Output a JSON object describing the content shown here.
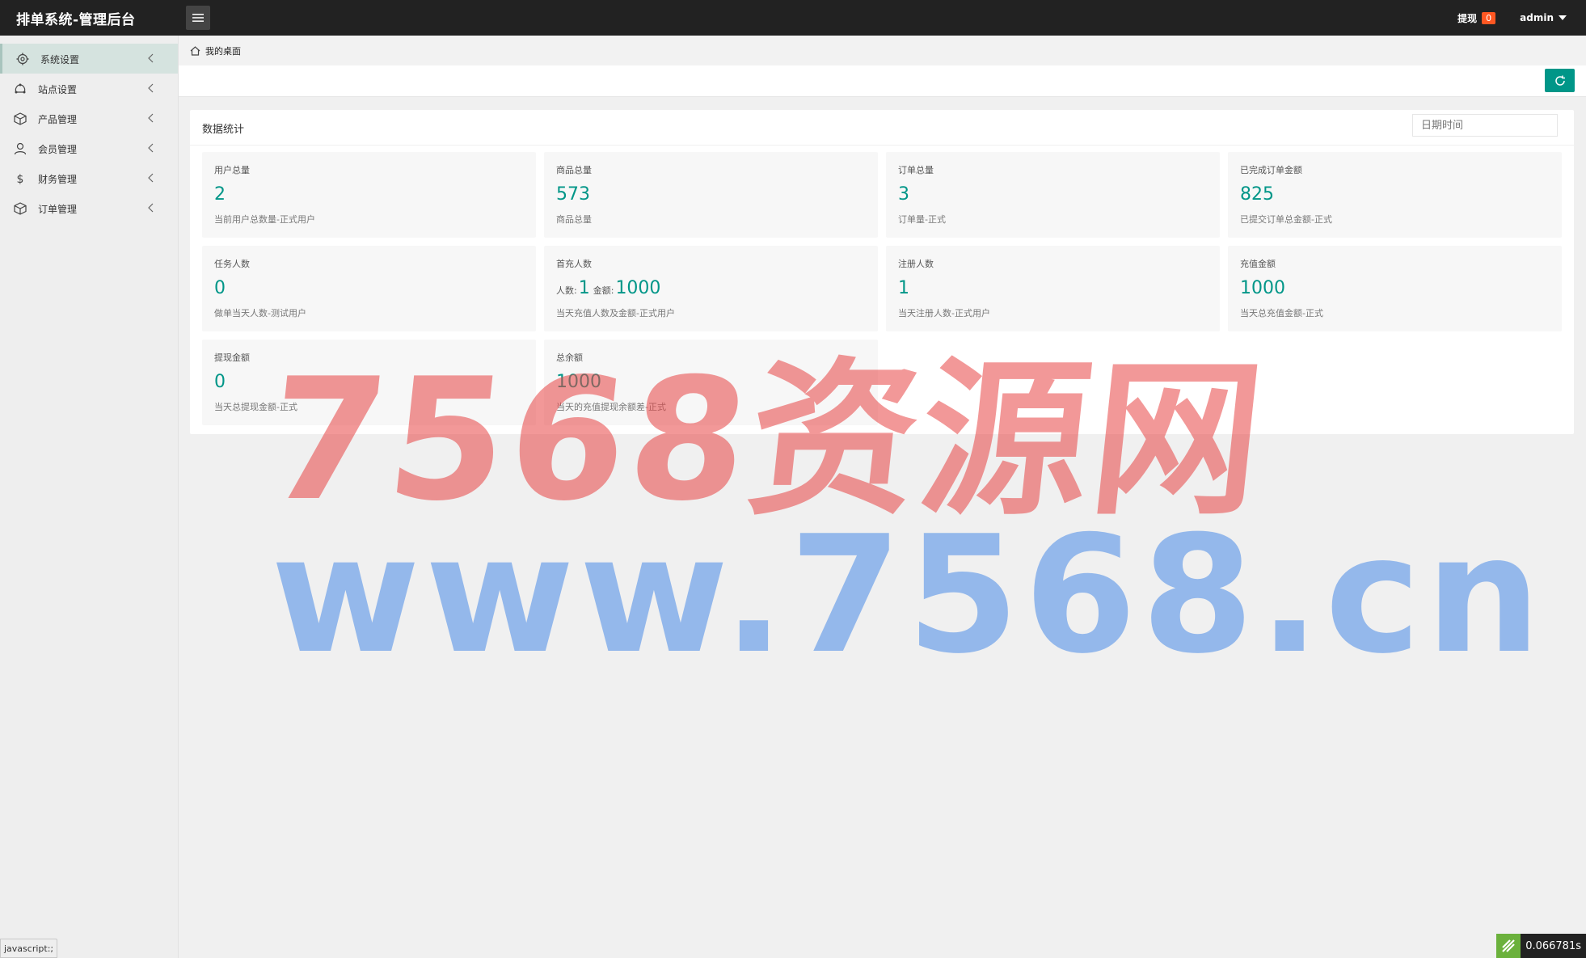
{
  "app": {
    "title": "排单系统-管理后台"
  },
  "topbar": {
    "withdraw_label": "提现",
    "withdraw_count": "0",
    "user": "admin"
  },
  "sidebar": {
    "items": [
      {
        "label": "系统设置",
        "icon": "gear-icon",
        "active": true
      },
      {
        "label": "站点设置",
        "icon": "sitemap-icon",
        "active": false
      },
      {
        "label": "产品管理",
        "icon": "box-icon",
        "active": false
      },
      {
        "label": "会员管理",
        "icon": "user-icon",
        "active": false
      },
      {
        "label": "财务管理",
        "icon": "dollar-icon",
        "active": false
      },
      {
        "label": "订单管理",
        "icon": "box-icon",
        "active": false
      }
    ]
  },
  "breadcrumb": {
    "label": "我的桌面"
  },
  "panel": {
    "title": "数据统计",
    "date_placeholder": "日期时间"
  },
  "cards": [
    {
      "title": "用户总量",
      "value": "2",
      "desc": "当前用户总数量-正式用户"
    },
    {
      "title": "商品总量",
      "value": "573",
      "desc": "商品总量"
    },
    {
      "title": "订单总量",
      "value": "3",
      "desc": "订单量-正式"
    },
    {
      "title": "已完成订单金额",
      "value": "825",
      "desc": "已提交订单总金额-正式"
    },
    {
      "title": "任务人数",
      "value": "0",
      "desc": "做单当天人数-测试用户"
    },
    {
      "title": "首充人数",
      "people_label": "人数:",
      "people_value": "1",
      "amount_label": "金额:",
      "amount_value": "1000",
      "desc": "当天充值人数及金额-正式用户"
    },
    {
      "title": "注册人数",
      "value": "1",
      "desc": "当天注册人数-正式用户"
    },
    {
      "title": "充值金额",
      "value": "1000",
      "desc": "当天总充值金额-正式"
    },
    {
      "title": "提现金额",
      "value": "0",
      "desc": "当天总提现金额-正式"
    },
    {
      "title": "总余额",
      "value": "1000",
      "desc": "当天的充值提现余额差-正式"
    }
  ],
  "watermark": {
    "line1": "7568资源网",
    "line2": "www.7568.cn"
  },
  "status": {
    "link": "javascript:;",
    "timer": "0.066781s"
  },
  "colors": {
    "accent": "#009688",
    "badge": "#ff5722",
    "topbar": "#222222"
  }
}
